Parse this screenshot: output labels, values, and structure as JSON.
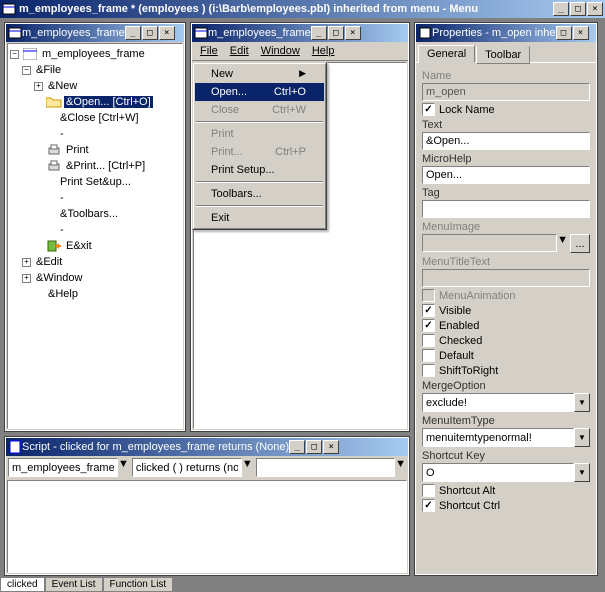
{
  "main_title": "m_employees_frame * (employees ) (i:\\Barb\\employees.pbl) inherited from menu - Menu",
  "tree_pane": {
    "title": "m_employees_frame",
    "root": "m_employees_frame",
    "file": "&File",
    "items": {
      "new": "&New",
      "open": "&Open...  [Ctrl+O]",
      "close": "&Close  [Ctrl+W]",
      "sep1": "-",
      "print": "Print",
      "print2": "&Print...  [Ctrl+P]",
      "printsetup": "Print Set&up...",
      "sep2": "-",
      "toolbars": "&Toolbars...",
      "sep3": "-",
      "exit": "E&xit"
    },
    "edit": "&Edit",
    "window": "&Window",
    "help": "&Help"
  },
  "menu_pane": {
    "title": "m_employees_frame",
    "menubar": [
      "File",
      "Edit",
      "Window",
      "Help"
    ],
    "dropdown": [
      {
        "label": "New",
        "accel": "",
        "arrow": true
      },
      {
        "label": "Open...",
        "accel": "Ctrl+O",
        "highlight": true
      },
      {
        "label": "Close",
        "accel": "Ctrl+W",
        "disabled": true
      },
      {
        "sep": true
      },
      {
        "label": "Print",
        "accel": "",
        "disabled": true
      },
      {
        "label": "Print...",
        "accel": "Ctrl+P",
        "disabled": true
      },
      {
        "label": "Print Setup...",
        "accel": ""
      },
      {
        "sep": true
      },
      {
        "label": "Toolbars...",
        "accel": ""
      },
      {
        "sep": true
      },
      {
        "label": "Exit",
        "accel": ""
      }
    ]
  },
  "props": {
    "title": "Properties - m_open  inhe",
    "tabs": [
      "General",
      "Toolbar"
    ],
    "name_label": "Name",
    "name_value": "m_open",
    "lockname_label": "Lock Name",
    "lockname_checked": true,
    "text_label": "Text",
    "text_value": "&Open...",
    "microhelp_label": "MicroHelp",
    "microhelp_value": "Open...",
    "tag_label": "Tag",
    "tag_value": "",
    "menuimage_label": "MenuImage",
    "menutitletext_label": "MenuTitleText",
    "menuanimation_label": "MenuAnimation",
    "visible_label": "Visible",
    "enabled_label": "Enabled",
    "checked_label": "Checked",
    "default_label": "Default",
    "shifttoright_label": "ShiftToRight",
    "mergeoption_label": "MergeOption",
    "mergeoption_value": "exclude!",
    "menuitemtype_label": "MenuItemType",
    "menuitemtype_value": "menuitemtypenormal!",
    "shortcutkey_label": "Shortcut Key",
    "shortcutkey_value": "O",
    "shortcutalt_label": "Shortcut Alt",
    "shortcutctrl_label": "Shortcut Ctrl"
  },
  "script": {
    "title": "Script - clicked for m_employees_frame returns (None)",
    "dd1": "m_employees_frame",
    "dd2": "clicked ( ) returns (non"
  },
  "bottom_tabs": [
    "clicked",
    "Event List",
    "Function List"
  ]
}
